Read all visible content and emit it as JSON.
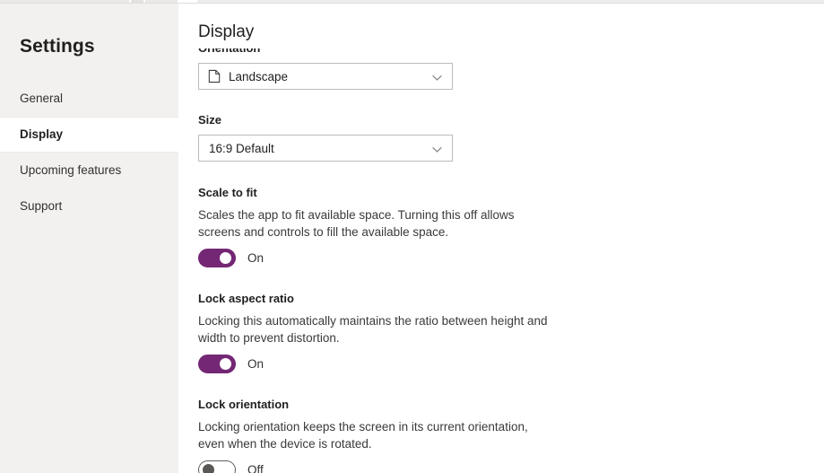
{
  "window": {
    "top_strip_present": true
  },
  "sidebar": {
    "title": "Settings",
    "items": [
      {
        "label": "General",
        "selected": false
      },
      {
        "label": "Display",
        "selected": true
      },
      {
        "label": "Upcoming features",
        "selected": false
      },
      {
        "label": "Support",
        "selected": false
      }
    ]
  },
  "main": {
    "page_title": "Display",
    "orientation": {
      "label": "Orientation",
      "value": "Landscape",
      "icon": "document-landscape-icon",
      "chevron": "chevron-down-icon"
    },
    "size": {
      "label": "Size",
      "value": "16:9 Default",
      "chevron": "chevron-down-icon"
    },
    "scale_to_fit": {
      "heading": "Scale to fit",
      "description": "Scales the app to fit available space. Turning this off allows screens and controls to fill the available space.",
      "toggle_state": "On"
    },
    "lock_aspect_ratio": {
      "heading": "Lock aspect ratio",
      "description": "Locking this automatically maintains the ratio between height and width to prevent distortion.",
      "toggle_state": "On"
    },
    "lock_orientation": {
      "heading": "Lock orientation",
      "description": "Locking orientation keeps the screen in its current orientation, even when the device is rotated.",
      "toggle_state": "Off"
    }
  },
  "colors": {
    "accent_purple": "#742774",
    "sidebar_background": "#f2f1f0",
    "text_primary": "#201f1e",
    "text_secondary": "#3b3a39",
    "border": "#bcbcbc"
  }
}
